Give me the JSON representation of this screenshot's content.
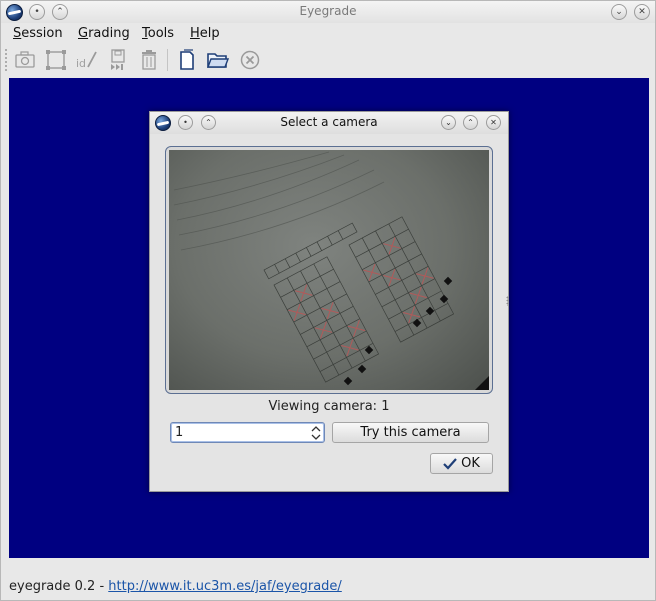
{
  "window": {
    "title": "Eyegrade"
  },
  "menu": [
    {
      "accel": "S",
      "rest": "ession"
    },
    {
      "accel": "G",
      "rest": "rading"
    },
    {
      "accel": "T",
      "rest": "ools"
    },
    {
      "accel": "H",
      "rest": "elp"
    }
  ],
  "toolbar": {
    "icons": [
      "camera-icon",
      "crop-icon",
      "edit-id-icon",
      "save-next-icon",
      "trash-icon",
      "new-document-icon",
      "open-folder-icon",
      "cancel-icon"
    ],
    "id_label": "id"
  },
  "canvas": {
    "background": "#000081"
  },
  "dialog": {
    "title": "Select a camera",
    "viewing_label": "Viewing camera: 1",
    "camera_select_value": "1",
    "try_button_label": "Try this camera",
    "ok_button_label": "OK"
  },
  "status": {
    "prefix": "eyegrade 0.2 - ",
    "link": "http://www.it.uc3m.es/jaf/eyegrade/"
  },
  "colors": {
    "accent": "#1b55a8",
    "canvas": "#000081"
  }
}
